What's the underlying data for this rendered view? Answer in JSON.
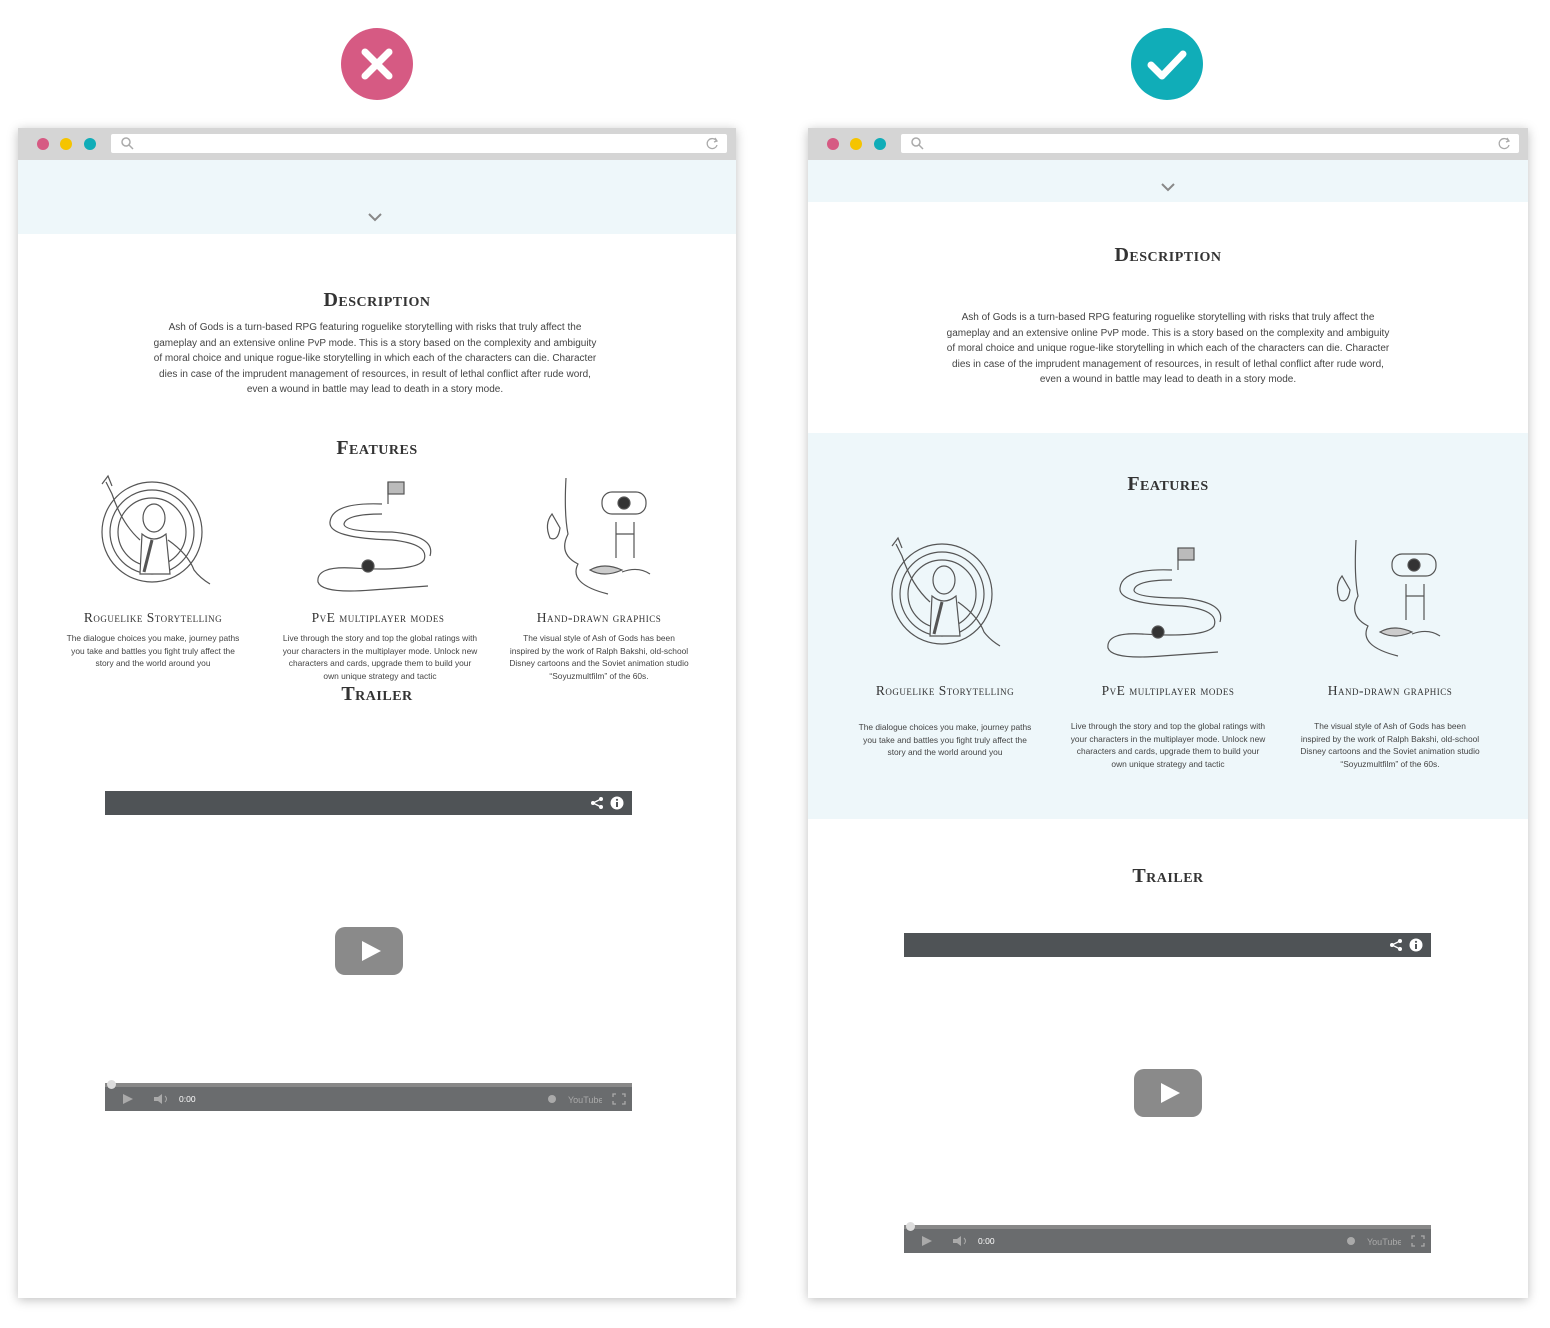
{
  "badges": {
    "wrong": "close-icon",
    "right": "check-icon"
  },
  "colors": {
    "wrong": "#d65a83",
    "right": "#10adb8",
    "band": "#eef7fa",
    "dot_red": "#d65a83",
    "dot_yellow": "#f5c400",
    "dot_teal": "#10adb8"
  },
  "page": {
    "description_title": "Description",
    "description_text": "Ash of Gods is a turn-based RPG featuring roguelike storytelling with risks that truly affect the gameplay and an extensive online PvP mode. This is a story based on the complexity and ambiguity of moral choice and unique rogue-like storytelling in which each of the characters can die. Character dies in case of the imprudent management of resources, in result of lethal conflict after rude word, even a wound in battle may lead to death in a story mode.",
    "features_title": "Features",
    "features": [
      {
        "title": "Roguelike Storytelling",
        "icon": "storyteller-illustration",
        "text": "The dialogue choices you make, journey paths you take and battles you fight truly affect the story and the world around you"
      },
      {
        "title": "PvE multiplayer modes",
        "icon": "winding-road-illustration",
        "text": "Live through the story and top the global ratings with your characters in the multiplayer mode. Unlock new characters and cards, upgrade them to build your own unique strategy and tactic"
      },
      {
        "title": "Hand-drawn graphics",
        "icon": "surreal-face-illustration",
        "text": "The visual style of Ash of Gods has been inspired by the work of Ralph Bakshi, old-school Disney cartoons and the Soviet animation studio “Soyuzmultfilm” of the 60s."
      }
    ],
    "trailer_title": "Trailer",
    "video": {
      "time": "0:00",
      "brand": "YouTube"
    }
  }
}
